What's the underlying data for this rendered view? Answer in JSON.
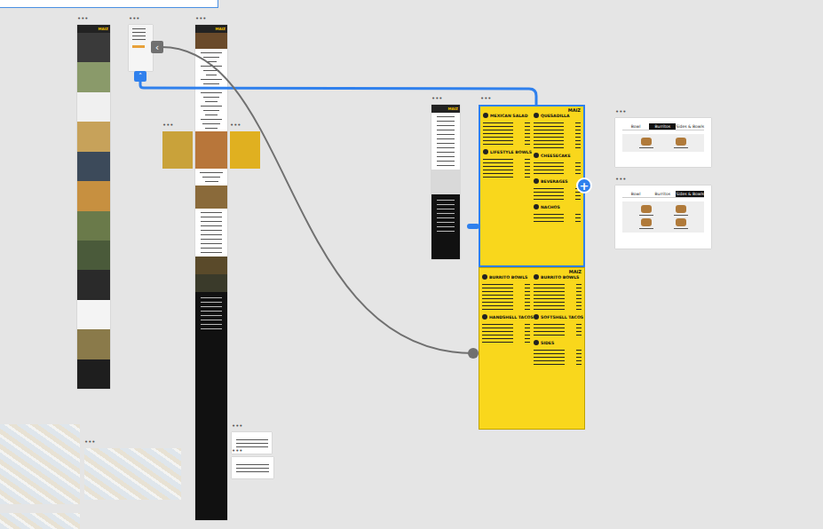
{
  "canvas": {
    "artboard_label": "•••"
  },
  "logo": "MAIZ",
  "connector_buttons": {
    "back": "‹",
    "up": "˄",
    "add": "+"
  },
  "menu_boards": [
    {
      "selected": true,
      "columns": [
        [
          {
            "title": "MEXICAN SALAD",
            "rows": 7
          },
          {
            "title": "LIFESTYLE BOWLS",
            "rows": 6
          }
        ],
        [
          {
            "title": "QUESADILLA",
            "rows": 8
          },
          {
            "title": "CHEESECAKE",
            "rows": 4
          },
          {
            "title": "BEVERAGES",
            "rows": 4
          },
          {
            "title": "NACHOS",
            "rows": 3
          }
        ]
      ]
    },
    {
      "selected": false,
      "columns": [
        [
          {
            "title": "BURRITO BOWLS",
            "rows": 8
          },
          {
            "title": "HANDSHELL TACOS",
            "rows": 6
          }
        ],
        [
          {
            "title": "BURRITO BOWLS",
            "rows": 8
          },
          {
            "title": "SOFTSHELL TACOS",
            "rows": 4
          },
          {
            "title": "SIDES",
            "rows": 5
          }
        ]
      ]
    }
  ],
  "tab_cards": [
    {
      "tabs": [
        {
          "label": "Bowl",
          "selected": false
        },
        {
          "label": "Burritos",
          "selected": true
        },
        {
          "label": "Sides & Bowls",
          "selected": false
        }
      ],
      "items": 2
    },
    {
      "tabs": [
        {
          "label": "Bowl",
          "selected": false
        },
        {
          "label": "Burritos",
          "selected": false
        },
        {
          "label": "Sides & Bowls",
          "selected": true
        }
      ],
      "items": 4
    }
  ]
}
